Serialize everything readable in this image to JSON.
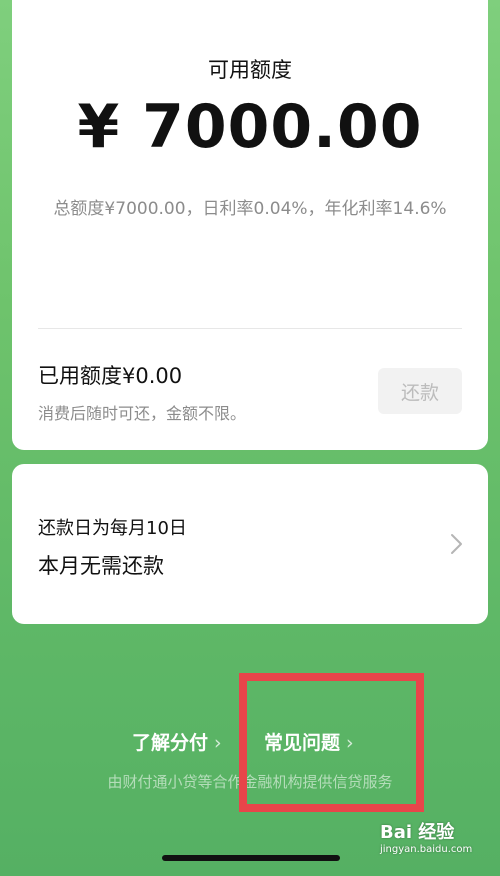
{
  "credit": {
    "available_title": "可用额度",
    "available_amount": "¥ 7000.00",
    "detail": "总额度¥7000.00，日利率0.04%，年化利率14.6%",
    "used_amount": "已用额度¥0.00",
    "used_note": "消费后随时可还，金额不限。",
    "repay_button": "还款"
  },
  "repayment": {
    "date_text": "还款日为每月10日",
    "status_text": "本月无需还款",
    "icon": "chevron-right-icon"
  },
  "footer": {
    "links": [
      {
        "label": "了解分付"
      },
      {
        "label": "常见问题"
      }
    ],
    "note": "由财付通小贷等合作金融机构提供信贷服务"
  },
  "watermark": {
    "brand": "Bai 经验",
    "url": "jingyan.baidu.com"
  },
  "colors": {
    "background_green": "#6ec36c",
    "annotation_red": "#e8454a",
    "disabled_button_bg": "#f2f2f2"
  }
}
